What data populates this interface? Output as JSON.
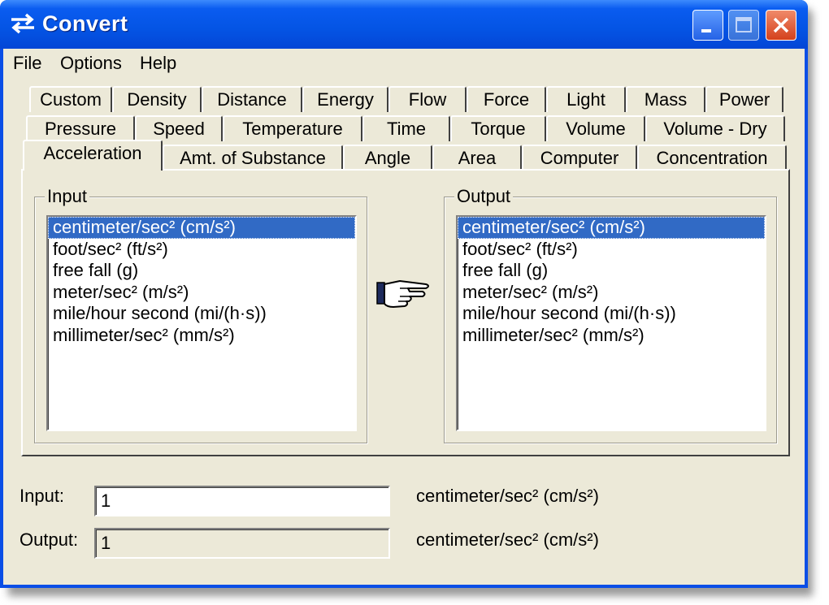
{
  "window": {
    "title": "Convert"
  },
  "menu": [
    "File",
    "Options",
    "Help"
  ],
  "tabs": {
    "row1": [
      "Custom",
      "Density",
      "Distance",
      "Energy",
      "Flow",
      "Force",
      "Light",
      "Mass",
      "Power"
    ],
    "row2": [
      "Pressure",
      "Speed",
      "Temperature",
      "Time",
      "Torque",
      "Volume",
      "Volume - Dry"
    ],
    "row3": [
      "Acceleration",
      "Amt. of Substance",
      "Angle",
      "Area",
      "Computer",
      "Concentration"
    ],
    "active": "Acceleration"
  },
  "input_group": {
    "label": "Input",
    "items": [
      "centimeter/sec² (cm/s²)",
      "foot/sec² (ft/s²)",
      "free fall (g)",
      "meter/sec² (m/s²)",
      "mile/hour second (mi/(h·s))",
      "millimeter/sec² (mm/s²)"
    ],
    "selected_index": 0
  },
  "output_group": {
    "label": "Output",
    "items": [
      "centimeter/sec² (cm/s²)",
      "foot/sec² (ft/s²)",
      "free fall (g)",
      "meter/sec² (m/s²)",
      "mile/hour second (mi/(h·s))",
      "millimeter/sec² (mm/s²)"
    ],
    "selected_index": 0
  },
  "convert_icon": "pointing-hand-icon",
  "fields": {
    "input_label": "Input:",
    "input_value": "1",
    "input_unit": "centimeter/sec² (cm/s²)",
    "output_label": "Output:",
    "output_value": "1",
    "output_unit": "centimeter/sec² (cm/s²)"
  },
  "colors": {
    "titlebar": "#0454e4",
    "selection": "#316ac5",
    "face": "#ece9d8",
    "close": "#d4411c"
  }
}
